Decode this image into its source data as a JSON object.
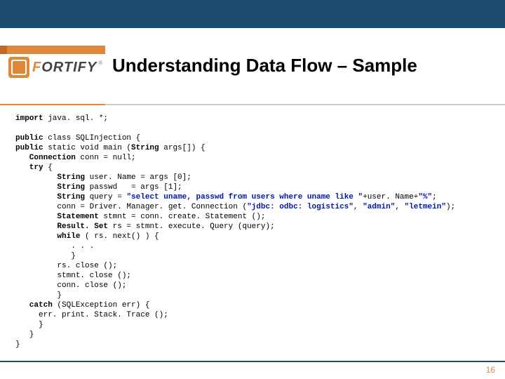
{
  "logo": {
    "brand_first": "F",
    "brand_rest": "ORTIFY"
  },
  "title": "Understanding Data Flow – Sample",
  "code": {
    "l1a": "import",
    "l1b": " java. sql. *;",
    "l2a": "public",
    "l2b": " class SQLInjection {",
    "l3a": "public",
    "l3b": " static void main (",
    "l3c": "String",
    "l3d": " args[]) {",
    "l4a": "   Connection",
    "l4b": " conn = null;",
    "l5a": "   try",
    "l5b": " {",
    "l6a": "         String",
    "l6b": " user. Name = args [0];",
    "l7a": "         String",
    "l7b": " passwd   = args [1];",
    "l8a": "         String",
    "l8b": " query = ",
    "l8c": "\"select uname, passwd from users where uname like \"",
    "l8d": "+user. Name+",
    "l8e": "\"%\"",
    "l8f": ";",
    "l9a": "         conn = Driver. Manager. get. Connection (",
    "l9b": "\"jdbc: odbc: logistics\"",
    "l9c": ", ",
    "l9d": "\"admin\"",
    "l9e": ", ",
    "l9f": "\"letmein\"",
    "l9g": ");",
    "l10a": "         Statement",
    "l10b": " stmnt = conn. create. Statement ();",
    "l11a": "         Result. Set",
    "l11b": " rs = stmnt. execute. Query (query);",
    "l12a": "         while",
    "l12b": " ( rs. next() ) {",
    "l13": "            . . . ",
    "l14": "            }",
    "l15": "         rs. close ();",
    "l16": "         stmnt. close ();",
    "l17": "         conn. close ();",
    "l18": "         }",
    "l19a": "   catch",
    "l19b": " (SQLException err) {",
    "l20": "     err. print. Stack. Trace ();",
    "l21": "     }",
    "l22": "   }",
    "l23": "}"
  },
  "page_number": "16"
}
